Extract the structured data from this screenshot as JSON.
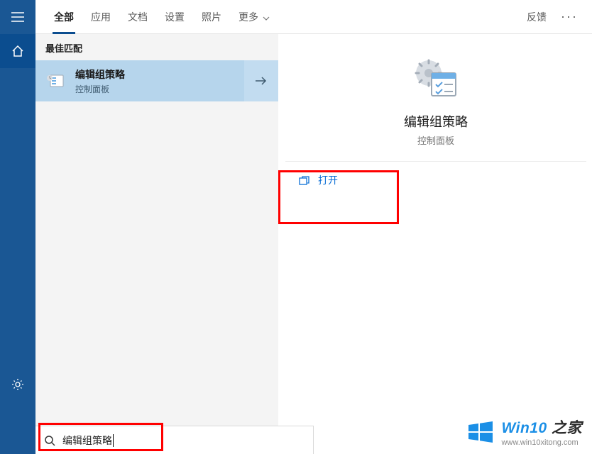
{
  "sidebar": {},
  "tabs": {
    "items": [
      "全部",
      "应用",
      "文档",
      "设置",
      "照片",
      "更多"
    ],
    "feedback": "反馈"
  },
  "left": {
    "section_header": "最佳匹配",
    "result": {
      "title": "编辑组策略",
      "subtitle": "控制面板"
    }
  },
  "detail": {
    "title": "编辑组策略",
    "subtitle": "控制面板",
    "open_label": "打开"
  },
  "search": {
    "value": "编辑组策略"
  },
  "watermark": {
    "brand_prefix": "Win10",
    "brand_suffix": "之家",
    "url": "www.win10xitong.com"
  }
}
